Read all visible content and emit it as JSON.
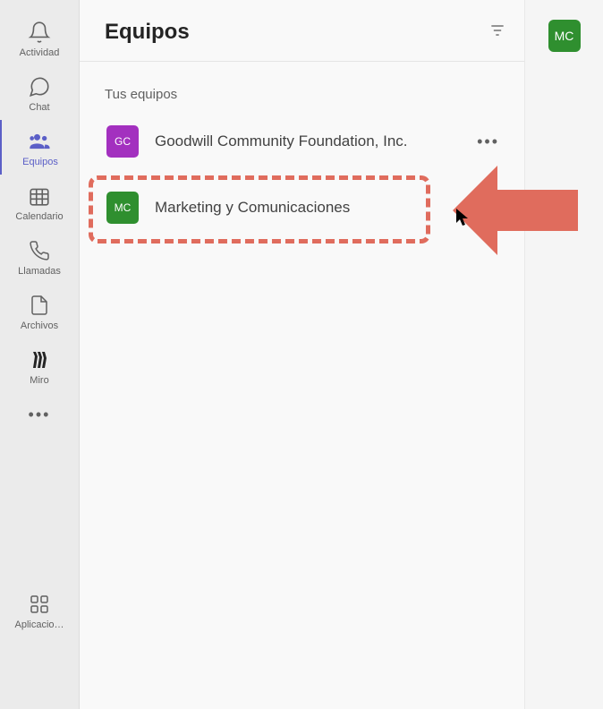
{
  "sidebar": {
    "items": [
      {
        "label": "Actividad"
      },
      {
        "label": "Chat"
      },
      {
        "label": "Equipos"
      },
      {
        "label": "Calendario"
      },
      {
        "label": "Llamadas"
      },
      {
        "label": "Archivos"
      },
      {
        "label": "Miro"
      }
    ],
    "apps_label": "Aplicacio…"
  },
  "header": {
    "title": "Equipos",
    "avatar_initials": "MC"
  },
  "teams": {
    "section_label": "Tus equipos",
    "list": [
      {
        "initials": "GC",
        "name": "Goodwill Community Foundation, Inc.",
        "color": "purple"
      },
      {
        "initials": "MC",
        "name": "Marketing y Comunicaciones",
        "color": "green"
      }
    ]
  },
  "colors": {
    "accent": "#5b5fc7",
    "highlight": "#e06c5d"
  }
}
